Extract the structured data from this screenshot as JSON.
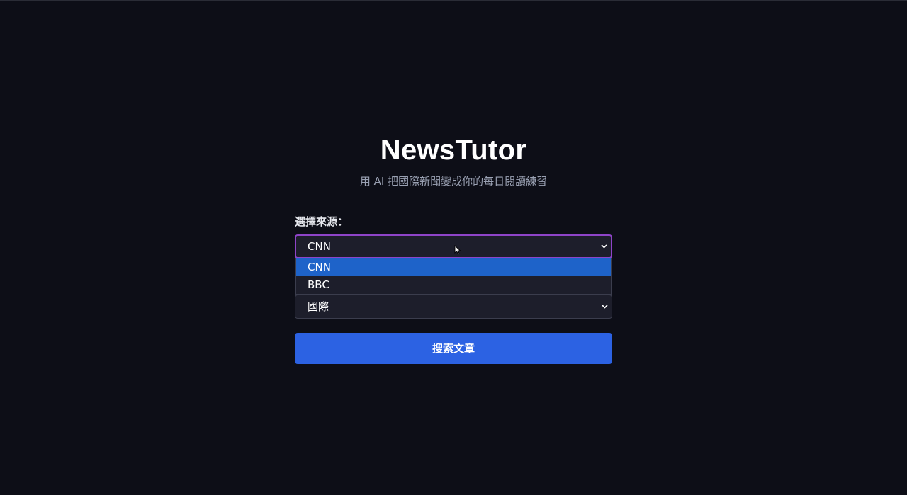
{
  "app": {
    "title": "NewsTutor",
    "subtitle": "用 AI 把國際新聞變成你的每日閱讀練習"
  },
  "source": {
    "label": "選擇來源：",
    "selected": "CNN",
    "options": [
      "CNN",
      "BBC"
    ]
  },
  "category": {
    "selected": "國際"
  },
  "search_button": {
    "label": "搜索文章"
  },
  "colors": {
    "background": "#0d0e17",
    "accent_button": "#2c62e3",
    "focus_border": "#8e44c8",
    "option_highlight": "#1e63c9"
  },
  "icons": {
    "dropdown_arrow": "chevron-down-icon",
    "cursor": "mouse-pointer-icon"
  }
}
